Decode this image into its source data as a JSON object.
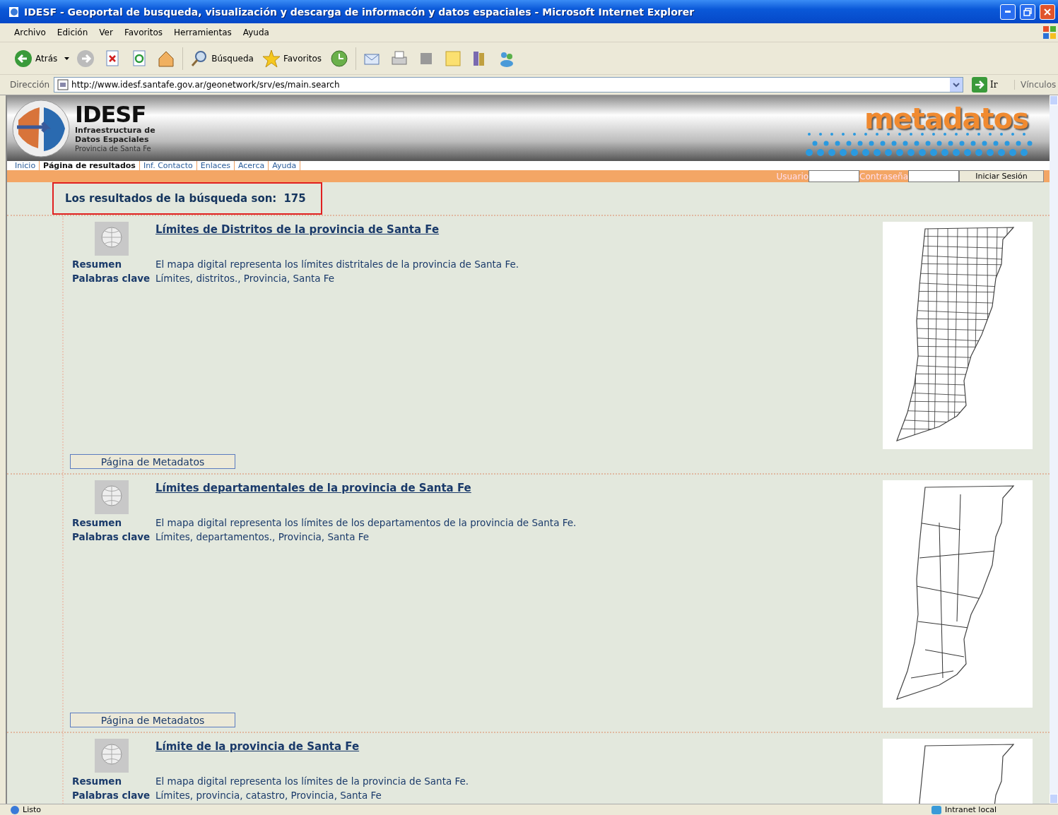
{
  "window": {
    "title": "IDESF - Geoportal de busqueda, visualización y descarga de informacón y datos espaciales - Microsoft Internet Explorer"
  },
  "menu": [
    "Archivo",
    "Edición",
    "Ver",
    "Favoritos",
    "Herramientas",
    "Ayuda"
  ],
  "toolbar": {
    "back": "Atrás",
    "search": "Búsqueda",
    "favorites": "Favoritos"
  },
  "address_bar": {
    "label": "Dirección",
    "url": "http://www.idesf.santafe.gov.ar/geonetwork/srv/es/main.search",
    "go": "Ir",
    "links": "Vínculos"
  },
  "header": {
    "logo_title": "IDESF",
    "logo_line_1": "Infraestructura de",
    "logo_line_2": "Datos Espaciales",
    "logo_line_3": "Provincia de Santa Fe",
    "banner_title": "metadatos"
  },
  "nav": [
    {
      "label": "Inicio",
      "selected": false
    },
    {
      "label": "Página de resultados",
      "selected": true
    },
    {
      "label": "Inf. Contacto",
      "selected": false
    },
    {
      "label": "Enlaces",
      "selected": false
    },
    {
      "label": "Acerca",
      "selected": false
    },
    {
      "label": "Ayuda",
      "selected": false
    }
  ],
  "login": {
    "user_label": "Usuario",
    "password_label": "Contraseña",
    "button": "Iniciar Sesión"
  },
  "results_summary": {
    "label": "Los resultados de la búsqueda son:",
    "count": "175"
  },
  "results": [
    {
      "title": "Límites de Distritos de la provincia de Santa Fe",
      "summary_label": "Resumen",
      "summary": "El mapa digital representa los límites distritales de la provincia de Santa Fe.",
      "keywords_label": "Palabras clave",
      "keywords": "Límites, distritos., Provincia, Santa Fe",
      "button": "Página de Metadatos",
      "kind": "districts"
    },
    {
      "title": "Límites departamentales de la provincia de Santa Fe",
      "summary_label": "Resumen",
      "summary": "El mapa digital representa los límites de los departamentos de la provincia de Santa Fe.",
      "keywords_label": "Palabras clave",
      "keywords": "Límites, departamentos., Provincia, Santa Fe",
      "button": "Página de Metadatos",
      "kind": "departments"
    },
    {
      "title": "Límite de la provincia de Santa Fe",
      "summary_label": "Resumen",
      "summary": "El mapa digital representa los límites de la provincia de Santa Fe.",
      "keywords_label": "Palabras clave",
      "keywords": "Límites, provincia, catastro, Provincia, Santa Fe",
      "kind": "outline"
    }
  ],
  "status_bar": {
    "status": "Listo",
    "zone": "Intranet local"
  }
}
